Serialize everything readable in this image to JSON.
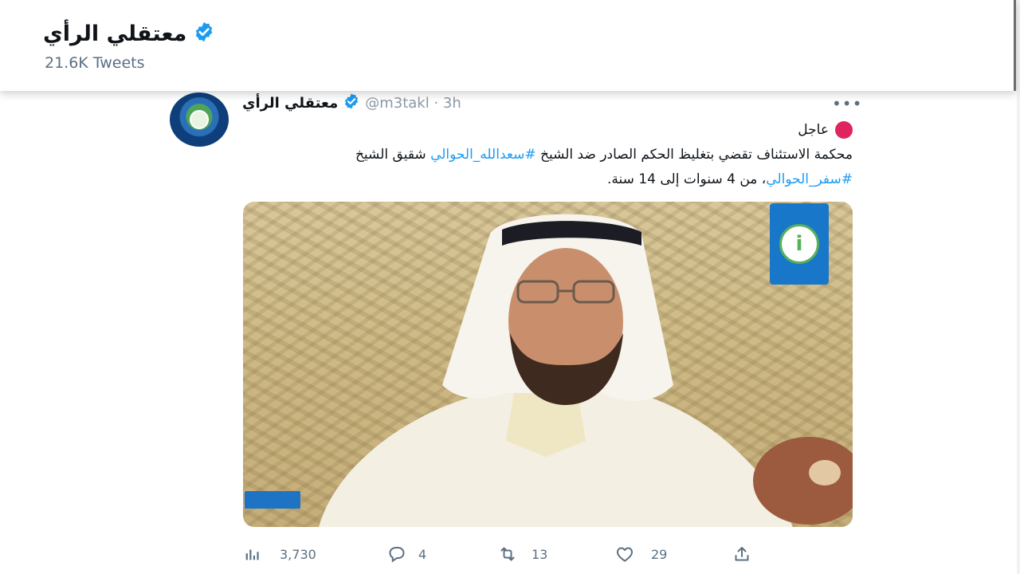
{
  "profile_header": {
    "name": "معتقلي الرأي",
    "tweet_count": "21.6K Tweets"
  },
  "tweet": {
    "author": "معتقلي الرأي",
    "handle_time": "@m3takl · 3h",
    "urgent_label": "عاجل",
    "line1_plain": "محكمة الاستئناف تقضي بتغليظ الحكم الصادر ضد الشيخ ",
    "line1_hashtag": "#سعدالله_الحوالي",
    "line1_tail": " شقيق الشيخ",
    "line2_hashtag": "#سفر_الحوالي",
    "line2_plain": "، من 4 سنوات إلى 14 سنة.",
    "media_tag": "",
    "stats": {
      "views": "3,730",
      "replies": "4",
      "retweets": "13",
      "likes": "29"
    }
  },
  "colors": {
    "accent": "#1d9bf0",
    "urgent": "#e0245e",
    "muted": "#5b7083"
  },
  "icons": [
    "verified-badge-icon",
    "views-icon",
    "reply-icon",
    "retweet-icon",
    "like-icon",
    "share-icon",
    "more-icon"
  ]
}
